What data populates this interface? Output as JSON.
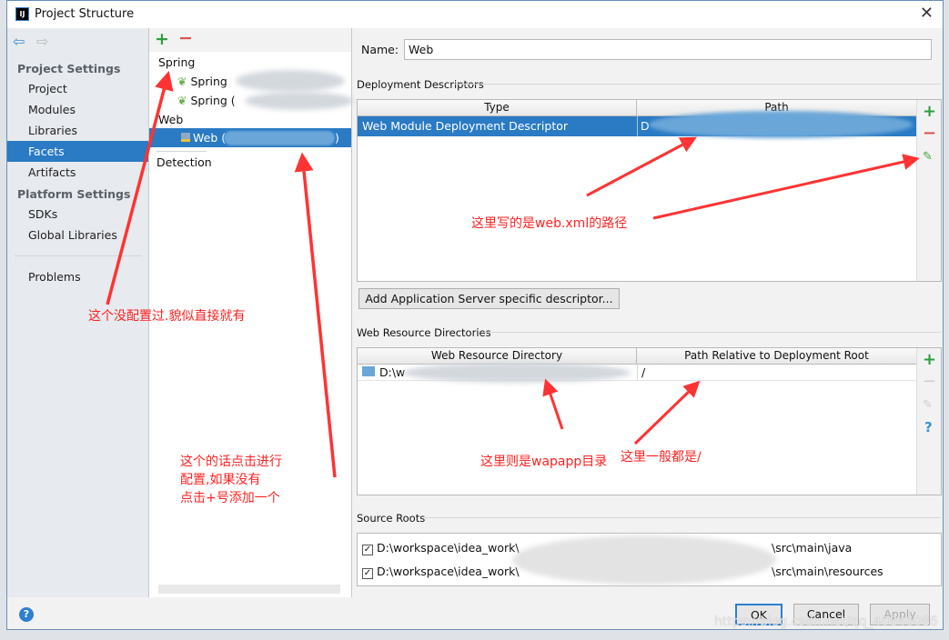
{
  "window": {
    "title": "Project Structure",
    "logo": "IJ"
  },
  "sidebar": {
    "sections": [
      {
        "label": "Project Settings",
        "items": [
          "Project",
          "Modules",
          "Libraries",
          "Facets",
          "Artifacts"
        ]
      },
      {
        "label": "Platform Settings",
        "items": [
          "SDKs",
          "Global Libraries"
        ]
      }
    ],
    "problems": "Problems",
    "selected": "Facets"
  },
  "facets": {
    "groups": [
      "Spring",
      "Web",
      "Detection"
    ],
    "spring_items": [
      "Spring",
      "Spring ("
    ],
    "web_item": "Web (",
    "web_item_end": ")"
  },
  "form": {
    "name_label": "Name:",
    "name_value": "Web"
  },
  "deployment": {
    "title": "Deployment Descriptors",
    "columns": [
      "Type",
      "Path"
    ],
    "rows": [
      {
        "type": "Web Module Deployment Descriptor",
        "path": "D"
      }
    ],
    "add_button": "Add Application Server specific descriptor..."
  },
  "resources": {
    "title": "Web Resource Directories",
    "columns": [
      "Web Resource Directory",
      "Path Relative to Deployment Root"
    ],
    "rows": [
      {
        "dir": "D:\\w",
        "path": "/"
      }
    ]
  },
  "source_roots": {
    "title": "Source Roots",
    "items": [
      {
        "prefix": "D:\\workspace\\idea_work\\",
        "suffix": "\\src\\main\\java",
        "checked": true
      },
      {
        "prefix": "D:\\workspace\\idea_work\\",
        "suffix": "\\src\\main\\resources",
        "checked": true
      }
    ]
  },
  "buttons": {
    "ok": "OK",
    "cancel": "Cancel",
    "apply": "Apply"
  },
  "annotations": {
    "a1": "这个没配置过.貌似直接就有",
    "a2": "这个的话点击进行\n配置,如果没有\n点击+号添加一个",
    "a3": "这里写的是web.xml的路径",
    "a4": "这里则是wapapp目录",
    "a5": "这里一般都是/"
  },
  "watermark": "https://blog.csdn.net/qq_40846086",
  "colors": {
    "selection": "#2a7ac4",
    "annotation": "#ff2222",
    "add": "#2e9e3e",
    "remove": "#d9534f"
  }
}
